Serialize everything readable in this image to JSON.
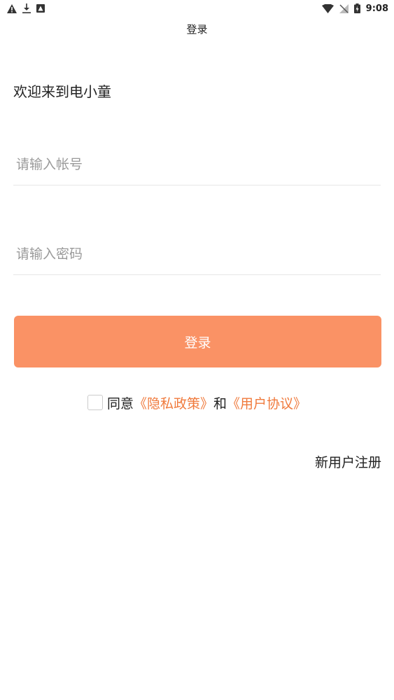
{
  "status_bar": {
    "time": "9:08",
    "left_icons": [
      "warning-icon",
      "download-icon",
      "app-notification-icon"
    ],
    "right_icons": [
      "wifi-icon",
      "no-sim-icon",
      "battery-icon"
    ]
  },
  "header": {
    "title": "登录"
  },
  "welcome": "欢迎来到电小童",
  "form": {
    "account_placeholder": "请输入帐号",
    "password_placeholder": "请输入密码",
    "login_label": "登录"
  },
  "agreement": {
    "prefix": "同意",
    "privacy_link": "《隐私政策》",
    "connector": "和",
    "user_link": "《用户协议》"
  },
  "register_label": "新用户注册",
  "colors": {
    "accent": "#fa9265",
    "link": "#f07a3c"
  }
}
